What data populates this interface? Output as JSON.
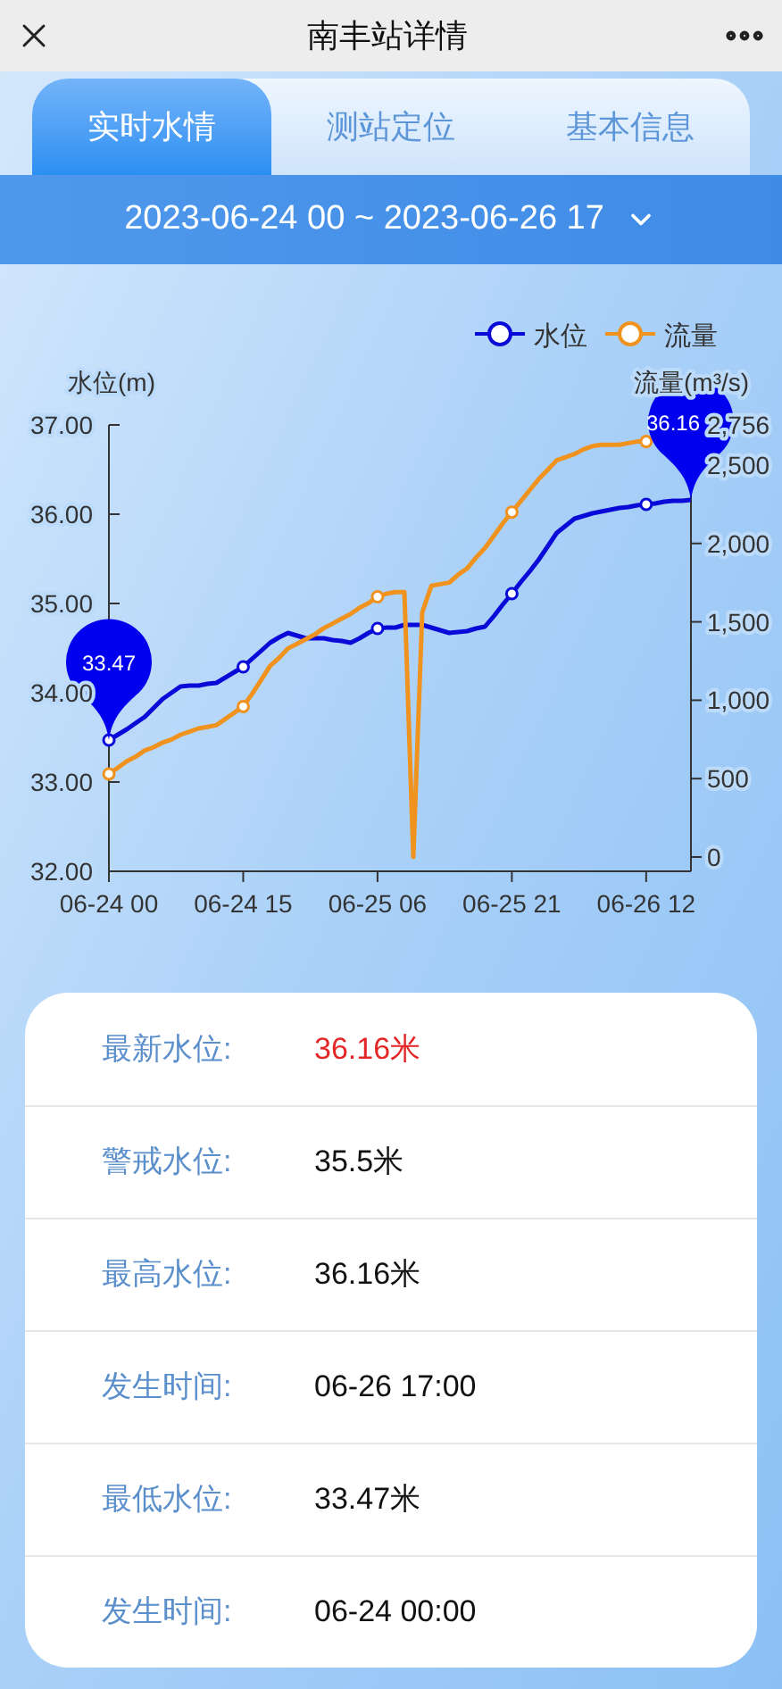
{
  "header": {
    "title": "南丰站详情"
  },
  "tabs": [
    {
      "label": "实时水情",
      "selected": true
    },
    {
      "label": "测站定位",
      "selected": false
    },
    {
      "label": "基本信息",
      "selected": false
    }
  ],
  "date_range": {
    "value": "2023-06-24 00 ~ 2023-06-26 17"
  },
  "chart": {
    "chart_data": {
      "type": "line",
      "legend": true,
      "ylabel": "水位(m)",
      "y2label": "流量(m³/s)",
      "categories": [
        "06-24 00",
        null,
        null,
        null,
        null,
        null,
        null,
        null,
        null,
        null,
        null,
        null,
        null,
        null,
        null,
        "06-24 15",
        null,
        null,
        null,
        null,
        null,
        null,
        null,
        null,
        null,
        null,
        null,
        null,
        null,
        null,
        "06-25 06",
        null,
        null,
        null,
        null,
        null,
        null,
        null,
        null,
        null,
        null,
        null,
        null,
        null,
        null,
        "06-25 21",
        null,
        null,
        null,
        null,
        null,
        null,
        null,
        null,
        null,
        null,
        null,
        null,
        null,
        null,
        "06-26 12",
        null,
        null,
        null,
        null,
        null
      ],
      "ylim": [
        32,
        37
      ],
      "yticks": [
        {
          "value": 32,
          "label": "32.00"
        },
        {
          "value": 33,
          "label": "33.00"
        },
        {
          "value": 34,
          "label": "34.00"
        },
        {
          "value": 35,
          "label": "35.00"
        },
        {
          "value": 36,
          "label": "36.00"
        },
        {
          "value": 37,
          "label": "37.00"
        }
      ],
      "y2lim": [
        -91,
        2756
      ],
      "y2ticks": [
        {
          "value": 0,
          "label": "0"
        },
        {
          "value": 500,
          "label": "500"
        },
        {
          "value": 1000,
          "label": "1,000"
        },
        {
          "value": 1500,
          "label": "1,500"
        },
        {
          "value": 2000,
          "label": "2,000"
        },
        {
          "value": 2500,
          "label": "2,500"
        },
        {
          "value": 2756,
          "label": "2,756"
        }
      ],
      "series": [
        {
          "name": "水位",
          "color": "#0a0ad8",
          "values": [
            33.47,
            33.53,
            33.59,
            33.66,
            33.73,
            33.83,
            33.93,
            34.0,
            34.07,
            34.08,
            34.08,
            34.1,
            34.11,
            34.17,
            34.23,
            34.29,
            34.38,
            34.47,
            34.56,
            34.62,
            34.67,
            34.64,
            34.61,
            34.61,
            34.61,
            34.59,
            34.58,
            34.56,
            34.61,
            34.67,
            34.72,
            34.73,
            34.73,
            34.76,
            34.76,
            34.76,
            34.73,
            34.7,
            34.67,
            34.68,
            34.69,
            34.72,
            34.74,
            34.86,
            34.99,
            35.11,
            35.24,
            35.36,
            35.49,
            35.64,
            35.79,
            35.87,
            35.95,
            35.98,
            36.01,
            36.03,
            36.05,
            36.07,
            36.08,
            36.1,
            36.11,
            36.12,
            36.14,
            36.15,
            36.15,
            36.16
          ]
        },
        {
          "name": "流量",
          "color": "#f0921e",
          "axis": "y2",
          "values": [
            530,
            570,
            610,
            640,
            680,
            700,
            730,
            750,
            780,
            800,
            820,
            830,
            840,
            880,
            920,
            960,
            1040,
            1130,
            1220,
            1270,
            1330,
            1360,
            1390,
            1420,
            1460,
            1490,
            1520,
            1550,
            1590,
            1620,
            1660,
            1680,
            1690,
            1690,
            0,
            1560,
            1730,
            1740,
            1750,
            1800,
            1840,
            1910,
            1970,
            2050,
            2130,
            2200,
            2270,
            2340,
            2410,
            2470,
            2530,
            2550,
            2570,
            2600,
            2620,
            2630,
            2630,
            2630,
            2640,
            2650,
            2650,
            null,
            null,
            null,
            null,
            null
          ]
        }
      ]
    },
    "series_end_pins": [
      {
        "kind": "start",
        "text": "33.47"
      },
      {
        "kind": "end",
        "text": "36.16"
      }
    ]
  },
  "info": [
    {
      "label": "最新水位:",
      "value": "36.16米",
      "alert": true
    },
    {
      "label": "警戒水位:",
      "value": "35.5米",
      "alert": false
    },
    {
      "label": "最高水位:",
      "value": "36.16米",
      "alert": false
    },
    {
      "label": "发生时间:",
      "value": "06-26 17:00",
      "alert": false
    },
    {
      "label": "最低水位:",
      "value": "33.47米",
      "alert": false
    },
    {
      "label": "发生时间:",
      "value": "06-24 00:00",
      "alert": false
    }
  ]
}
